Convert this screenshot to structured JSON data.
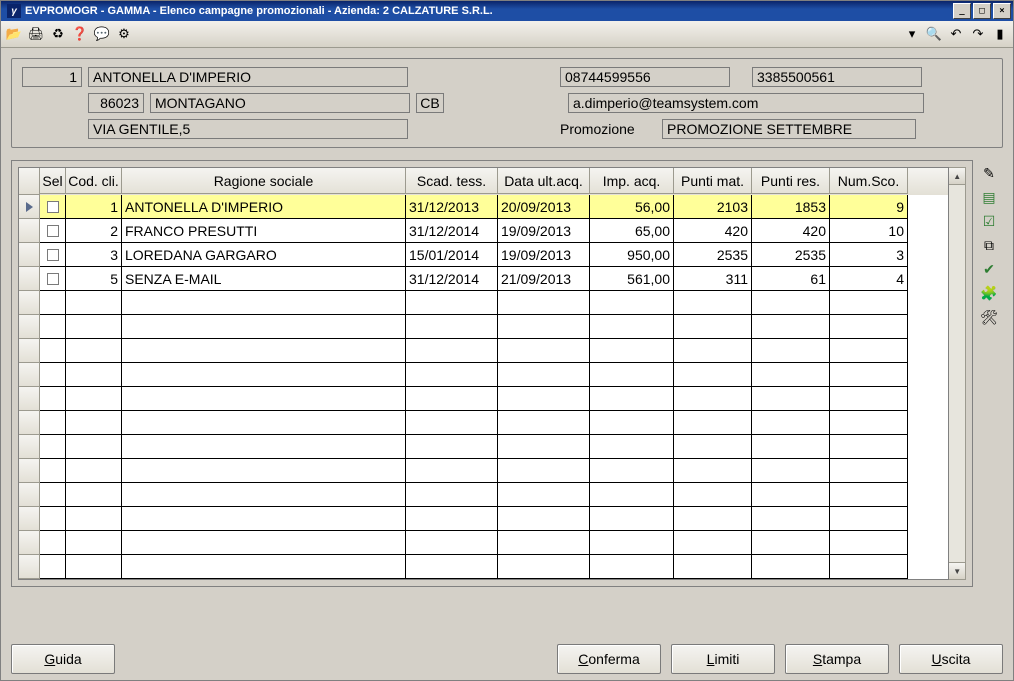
{
  "window": {
    "title": "EVPROMOGR - GAMMA - Elenco campagne promozionali - Azienda:   2 CALZATURE S.R.L."
  },
  "detail": {
    "cod": "1",
    "nome": "ANTONELLA D'IMPERIO",
    "tel1": "08744599556",
    "tel2": "3385500561",
    "cap": "86023",
    "citta": "MONTAGANO",
    "prov": "CB",
    "email": "a.dimperio@teamsystem.com",
    "indirizzo": "VIA GENTILE,5",
    "promo_label": "Promozione",
    "promo_val": "PROMOZIONE SETTEMBRE"
  },
  "columns": {
    "sel": "Sel",
    "cod": "Cod. cli.",
    "rag": "Ragione sociale",
    "scad": "Scad. tess.",
    "data": "Data ult.acq.",
    "imp": "Imp. acq.",
    "pm": "Punti mat.",
    "pr": "Punti res.",
    "ns": "Num.Sco."
  },
  "rows": [
    {
      "active": true,
      "cod": "1",
      "rag": "ANTONELLA D'IMPERIO",
      "scad": "31/12/2013",
      "data": "20/09/2013",
      "imp": "56,00",
      "pm": "2103",
      "pr": "1853",
      "ns": "9"
    },
    {
      "active": false,
      "cod": "2",
      "rag": "FRANCO PRESUTTI",
      "scad": "31/12/2014",
      "data": "19/09/2013",
      "imp": "65,00",
      "pm": "420",
      "pr": "420",
      "ns": "10"
    },
    {
      "active": false,
      "cod": "3",
      "rag": "LOREDANA GARGARO",
      "scad": "15/01/2014",
      "data": "19/09/2013",
      "imp": "950,00",
      "pm": "2535",
      "pr": "2535",
      "ns": "3"
    },
    {
      "active": false,
      "cod": "5",
      "rag": "SENZA E-MAIL",
      "scad": "31/12/2014",
      "data": "21/09/2013",
      "imp": "561,00",
      "pm": "311",
      "pr": "61",
      "ns": "4"
    }
  ],
  "buttons": {
    "guida": "Guida",
    "conferma": "Conferma",
    "limiti": "Limiti",
    "stampa": "Stampa",
    "uscita": "Uscita"
  },
  "icons": {
    "folder": "📂",
    "print": "🖨",
    "refresh": "♻",
    "help": "❓",
    "comment": "💬",
    "gear": "⚙",
    "chevdown": "▾",
    "search": "🔍",
    "undo": "↶",
    "redo": "↷",
    "exit": "▮",
    "wand": "✎",
    "excel": "▤",
    "check": "☑",
    "copy": "⧉",
    "ok": "✔",
    "puzzle": "🧩",
    "tools": "🛠"
  },
  "empty_rows": 12
}
